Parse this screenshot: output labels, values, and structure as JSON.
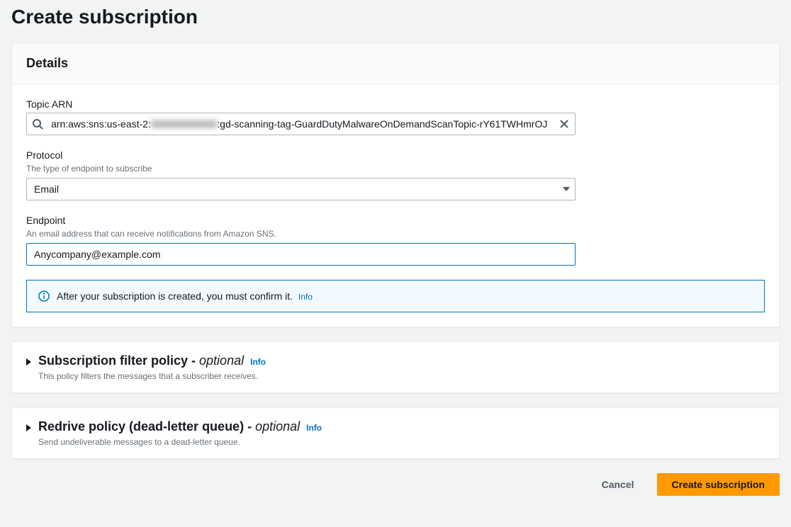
{
  "page": {
    "title": "Create subscription"
  },
  "details": {
    "heading": "Details",
    "topic_arn": {
      "label": "Topic ARN",
      "value_prefix": "arn:aws:sns:us-east-2:",
      "value_redacted": "000000000000",
      "value_suffix": ":gd-scanning-tag-GuardDutyMalwareOnDemandScanTopic-rY61TWHmrOJ"
    },
    "protocol": {
      "label": "Protocol",
      "hint": "The type of endpoint to subscribe",
      "value": "Email"
    },
    "endpoint": {
      "label": "Endpoint",
      "hint": "An email address that can receive notifications from Amazon SNS.",
      "value": "Anycompany@example.com"
    },
    "confirm_info": {
      "text": "After your subscription is created, you must confirm it.",
      "link": "Info"
    }
  },
  "filter_policy": {
    "title_main": "Subscription filter policy - ",
    "title_optional": "optional",
    "info_link": "Info",
    "desc": "This policy filters the messages that a subscriber receives."
  },
  "redrive_policy": {
    "title_main": "Redrive policy (dead-letter queue) - ",
    "title_optional": "optional",
    "info_link": "Info",
    "desc": "Send undeliverable messages to a dead-letter queue."
  },
  "actions": {
    "cancel": "Cancel",
    "submit": "Create subscription"
  }
}
